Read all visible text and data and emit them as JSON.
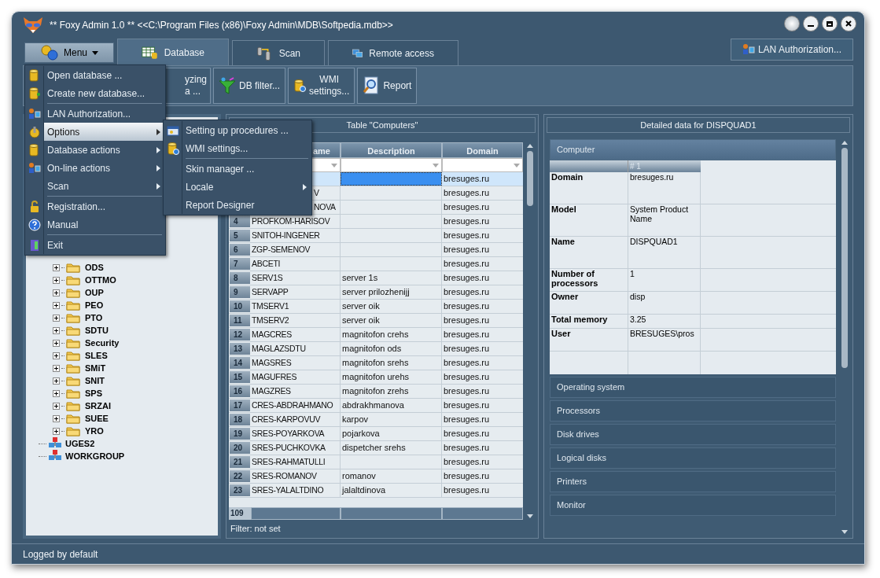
{
  "window": {
    "title": "** Foxy Admin 1.0 ** <<C:\\Program Files (x86)\\Foxy Admin\\MDB\\Softpedia.mdb>>"
  },
  "menu_button": {
    "label": "Menu"
  },
  "tabs": [
    {
      "label": "Database",
      "kind": "database",
      "selected": true
    },
    {
      "label": "Scan",
      "kind": "scan",
      "selected": false
    },
    {
      "label": "Remote access",
      "kind": "remote",
      "selected": false
    }
  ],
  "lan_button": {
    "label": "LAN Authorization..."
  },
  "toolbar": [
    {
      "kind": "partial",
      "lines": [
        "yzing",
        "a ..."
      ]
    },
    {
      "kind": "filter",
      "lines": [
        "DB filter..."
      ]
    },
    {
      "kind": "wmi",
      "lines": [
        "WMI",
        "settings..."
      ]
    },
    {
      "kind": "report",
      "lines": [
        "Report"
      ]
    }
  ],
  "main_menu": [
    {
      "kind": "item",
      "label": "Open database ...",
      "submenu": false,
      "selected": false
    },
    {
      "kind": "item",
      "label": "Create new database...",
      "submenu": false,
      "selected": false
    },
    {
      "kind": "separator"
    },
    {
      "kind": "item",
      "label": "LAN Authorization...",
      "submenu": false,
      "selected": false
    },
    {
      "kind": "item",
      "label": "Options",
      "submenu": true,
      "selected": true
    },
    {
      "kind": "item",
      "label": "Database actions",
      "submenu": true,
      "selected": false
    },
    {
      "kind": "item",
      "label": "On-line actions",
      "submenu": true,
      "selected": false
    },
    {
      "kind": "item",
      "label": "Scan",
      "submenu": true,
      "selected": false
    },
    {
      "kind": "separator"
    },
    {
      "kind": "item",
      "label": "Registration...",
      "submenu": false,
      "selected": false
    },
    {
      "kind": "item",
      "label": "Manual",
      "submenu": false,
      "selected": false
    },
    {
      "kind": "separator"
    },
    {
      "kind": "item",
      "label": "Exit",
      "submenu": false,
      "selected": false
    }
  ],
  "options_submenu": [
    {
      "kind": "item",
      "label": "Setting up procedures ...",
      "submenu": false
    },
    {
      "kind": "item",
      "label": "WMI settings...",
      "submenu": false
    },
    {
      "kind": "separator"
    },
    {
      "kind": "item",
      "label": "Skin manager ...",
      "submenu": false
    },
    {
      "kind": "item",
      "label": "Locale",
      "submenu": true
    },
    {
      "kind": "item",
      "label": "Report Designer",
      "submenu": false
    }
  ],
  "tree": [
    {
      "kind": "folder",
      "label": "ODS"
    },
    {
      "kind": "folder",
      "label": "OTTMO"
    },
    {
      "kind": "folder",
      "label": "OUP"
    },
    {
      "kind": "folder",
      "label": "PEO"
    },
    {
      "kind": "folder",
      "label": "PTO"
    },
    {
      "kind": "folder",
      "label": "SDTU"
    },
    {
      "kind": "folder",
      "label": "Security"
    },
    {
      "kind": "folder",
      "label": "SLES"
    },
    {
      "kind": "folder",
      "label": "SMiT"
    },
    {
      "kind": "folder",
      "label": "SNIT"
    },
    {
      "kind": "folder",
      "label": "SPS"
    },
    {
      "kind": "folder",
      "label": "SRZAI"
    },
    {
      "kind": "folder",
      "label": "SUEE"
    },
    {
      "kind": "folder",
      "label": "YRO"
    },
    {
      "kind": "network",
      "label": "UGES2"
    },
    {
      "kind": "network",
      "label": "WORKGROUP"
    }
  ],
  "table": {
    "title": "Table \"Computers\"",
    "columns": [
      "ame",
      "Description",
      "Domain"
    ],
    "rows": [
      {
        "kind": "covered",
        "number": "",
        "name": "",
        "description": "",
        "domain": "bresuges.ru",
        "selected": true
      },
      {
        "kind": "covered",
        "number": "",
        "name": "V",
        "description": "",
        "domain": "bresuges.ru",
        "selected": false
      },
      {
        "kind": "covered",
        "number": "",
        "name": "NOVA",
        "description": "",
        "domain": "bresuges.ru",
        "selected": false
      },
      {
        "kind": "full",
        "number": "4",
        "name": "PROFKOM-HARISOV",
        "description": "",
        "domain": "bresuges.ru",
        "selected": false
      },
      {
        "kind": "full",
        "number": "5",
        "name": "SNITOH-INGENER",
        "description": "",
        "domain": "bresuges.ru",
        "selected": false
      },
      {
        "kind": "full",
        "number": "6",
        "name": "ZGP-SEMENOV",
        "description": "",
        "domain": "bresuges.ru",
        "selected": false
      },
      {
        "kind": "full",
        "number": "7",
        "name": "ABCETI",
        "description": "",
        "domain": "bresuges.ru",
        "selected": false
      },
      {
        "kind": "full",
        "number": "8",
        "name": "SERV1S",
        "description": "server 1s",
        "domain": "bresuges.ru",
        "selected": false
      },
      {
        "kind": "full",
        "number": "9",
        "name": "SERVAPP",
        "description": "server prilozhenijj",
        "domain": "bresuges.ru",
        "selected": false
      },
      {
        "kind": "full",
        "number": "10",
        "name": "TMSERV1",
        "description": "server oik",
        "domain": "bresuges.ru",
        "selected": false
      },
      {
        "kind": "full",
        "number": "11",
        "name": "TMSERV2",
        "description": "server oik",
        "domain": "bresuges.ru",
        "selected": false
      },
      {
        "kind": "full",
        "number": "12",
        "name": "MAGCRES",
        "description": "magnitofon crehs",
        "domain": "bresuges.ru",
        "selected": false
      },
      {
        "kind": "full",
        "number": "13",
        "name": "MAGLAZSDTU",
        "description": "magnitofon ods",
        "domain": "bresuges.ru",
        "selected": false
      },
      {
        "kind": "full",
        "number": "14",
        "name": "MAGSRES",
        "description": "magnitofon srehs",
        "domain": "bresuges.ru",
        "selected": false
      },
      {
        "kind": "full",
        "number": "15",
        "name": "MAGUFRES",
        "description": "magnitofon urehs",
        "domain": "bresuges.ru",
        "selected": false
      },
      {
        "kind": "full",
        "number": "16",
        "name": "MAGZRES",
        "description": "magnitofon zrehs",
        "domain": "bresuges.ru",
        "selected": false
      },
      {
        "kind": "full",
        "number": "17",
        "name": "CRES-ABDRAHMANO",
        "description": "abdrakhmanova",
        "domain": "bresuges.ru",
        "selected": false
      },
      {
        "kind": "full",
        "number": "18",
        "name": "CRES-KARPOVUV",
        "description": "karpov",
        "domain": "bresuges.ru",
        "selected": false
      },
      {
        "kind": "full",
        "number": "19",
        "name": "SRES-POYARKOVA",
        "description": "pojarkova",
        "domain": "bresuges.ru",
        "selected": false
      },
      {
        "kind": "full",
        "number": "20",
        "name": "SRES-PUCHKOVKA",
        "description": "dispetcher srehs",
        "domain": "bresuges.ru",
        "selected": false
      },
      {
        "kind": "full",
        "number": "21",
        "name": "SRES-RAHMATULLI",
        "description": "",
        "domain": "bresuges.ru",
        "selected": false
      },
      {
        "kind": "full",
        "number": "22",
        "name": "SRES-ROMANOV",
        "description": "romanov",
        "domain": "bresuges.ru",
        "selected": false
      },
      {
        "kind": "full",
        "number": "23",
        "name": "SRES-YALALTDINO",
        "description": "jalaltdinova",
        "domain": "bresuges.ru",
        "selected": false
      }
    ],
    "count": "109",
    "filter": "Filter: not set"
  },
  "details": {
    "title": "Detailed data for DISPQUAD1",
    "sections": [
      {
        "label": "Computer",
        "expanded": true,
        "column": "# 1",
        "properties": [
          {
            "name": "Domain",
            "value": "bresuges.ru",
            "kind": "tall"
          },
          {
            "name": "Model",
            "value": "System Product Name",
            "kind": "tall"
          },
          {
            "name": "Name",
            "value": "DISPQUAD1",
            "kind": "tall"
          },
          {
            "name": "Number of processors",
            "value": "1",
            "kind": "medium"
          },
          {
            "name": "Owner",
            "value": "disp",
            "kind": "medium"
          },
          {
            "name": "Total memory",
            "value": "3.25",
            "kind": "short"
          },
          {
            "name": "User",
            "value": "BRESUGES\\pros",
            "kind": "medium"
          }
        ]
      },
      {
        "label": "Operating system",
        "expanded": false
      },
      {
        "label": "Processors",
        "expanded": false
      },
      {
        "label": "Disk drives",
        "expanded": false
      },
      {
        "label": "Logical disks",
        "expanded": false
      },
      {
        "label": "Printers",
        "expanded": false
      },
      {
        "label": "Monitor",
        "expanded": false
      }
    ]
  },
  "status_bar": "Logged by default"
}
